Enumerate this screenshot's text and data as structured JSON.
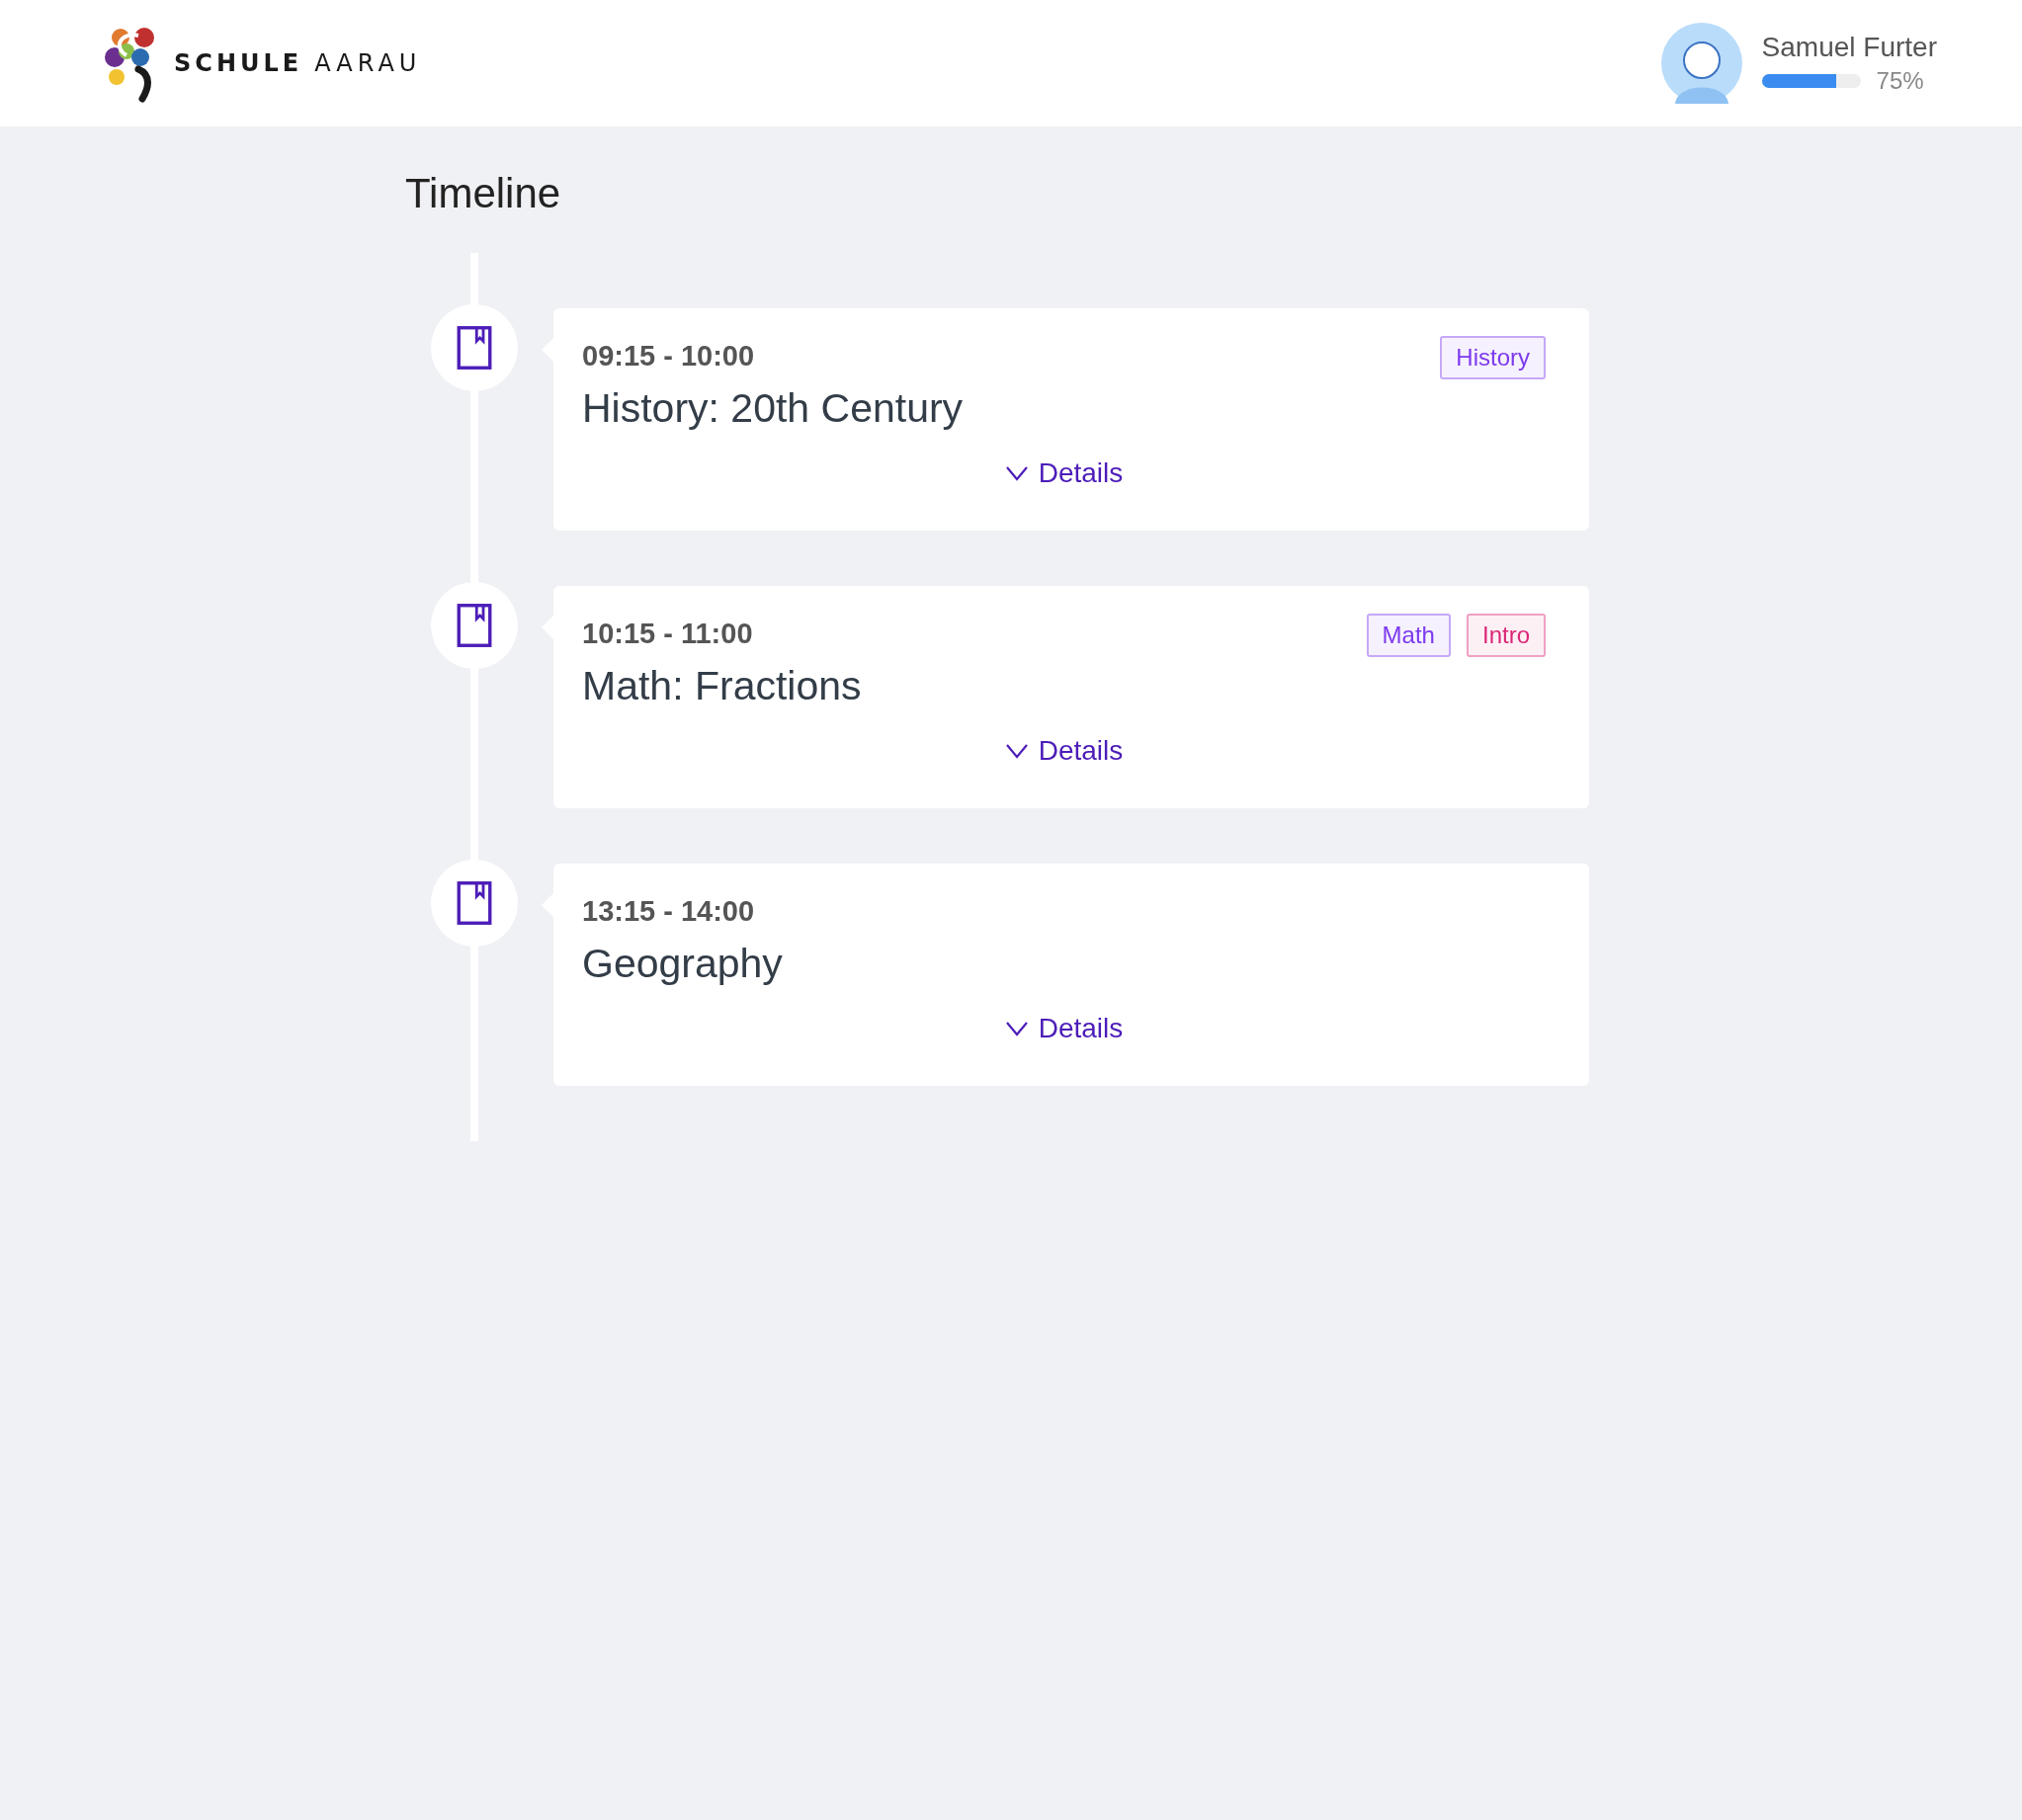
{
  "header": {
    "logo": {
      "word_1": "SCHULE",
      "word_2": "AARAU"
    },
    "user": {
      "name": "Samuel Furter",
      "progress": {
        "level": 0.75,
        "reading": "75%"
      }
    }
  },
  "page_title": "Timeline",
  "timeline": [
    {
      "time": "09:15 - 10:00",
      "title": "History: 20th Century",
      "tags": [
        {
          "label": "History",
          "color": "#7c3aed"
        }
      ],
      "details": "Details",
      "expanded": false
    },
    {
      "time": "10:15 - 11:00",
      "title": "Math: Fractions",
      "tags": [
        {
          "label": "Math",
          "color": "#7c3aed"
        },
        {
          "label": "Intro",
          "color": "#db2777"
        }
      ],
      "details": "Details",
      "expanded": false
    },
    {
      "time": "13:15 - 14:00",
      "title": "Geography",
      "details": "Details",
      "expanded": false
    }
  ]
}
